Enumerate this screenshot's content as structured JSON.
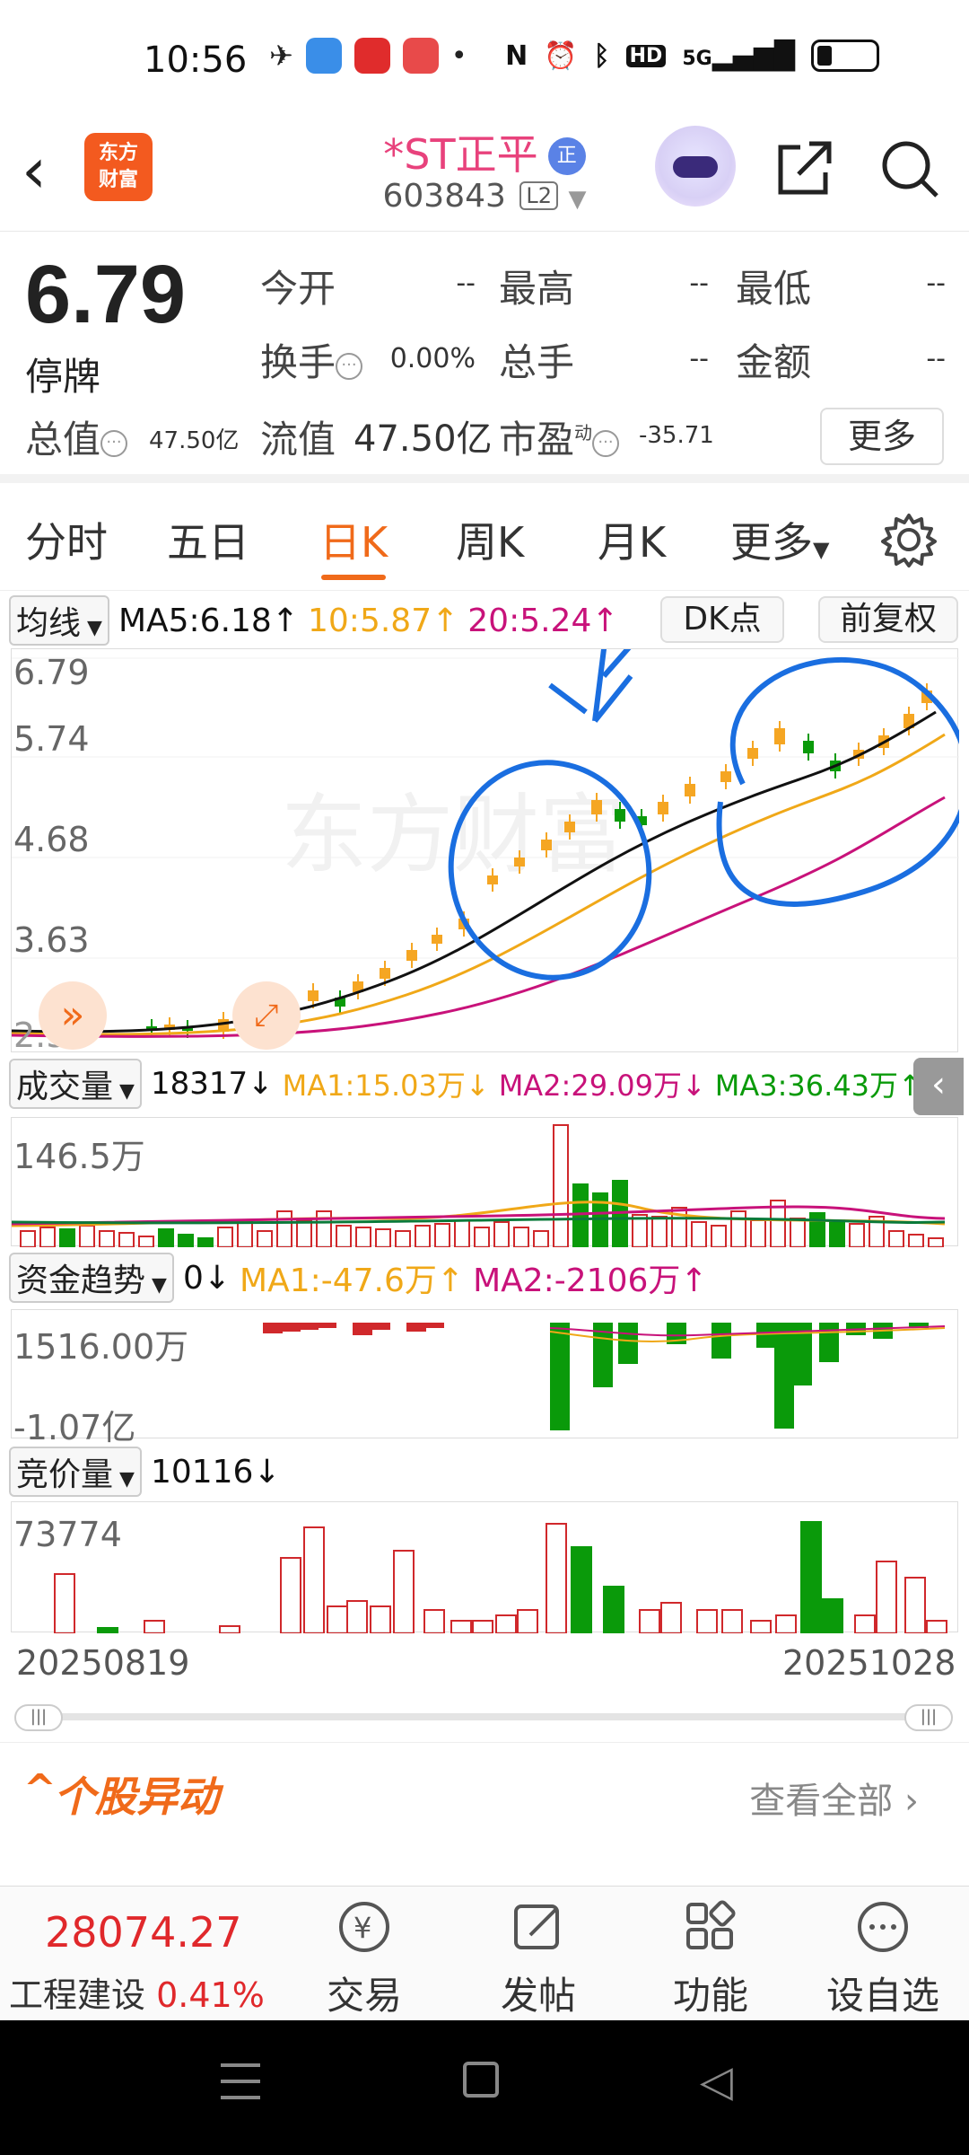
{
  "status_bar": {
    "time": "10:56",
    "network": "5G",
    "hd": "HD"
  },
  "header": {
    "back_icon": "chevron-left-icon",
    "logo_text_line1": "东方",
    "logo_text_line2": "财富",
    "stock_name": "*ST正平",
    "stock_badge": "正",
    "stock_code": "603843",
    "level": "L2"
  },
  "quote": {
    "price": "6.79",
    "status": "停牌",
    "open_label": "今开",
    "open_value": "--",
    "high_label": "最高",
    "high_value": "--",
    "low_label": "最低",
    "low_value": "--",
    "turnover_label": "换手",
    "turnover_value": "0.00%",
    "volume_label": "总手",
    "volume_value": "--",
    "amount_label": "金额",
    "amount_value": "--",
    "total_value_label": "总值",
    "total_value": "47.50亿",
    "float_value_label": "流值",
    "float_value": "47.50亿",
    "pe_label": "市盈",
    "pe_sup": "动",
    "pe_value": "-35.71",
    "more": "更多"
  },
  "tabs": [
    "分时",
    "五日",
    "日K",
    "周K",
    "月K",
    "更多"
  ],
  "active_tab": "日K",
  "kline": {
    "ma_dropdown": "均线",
    "ma5": "MA5:6.18",
    "ma10": "10:5.87",
    "ma20": "20:5.24",
    "dk_button": "DK点",
    "adjust_button": "前复权",
    "y_labels": [
      "6.79",
      "5.74",
      "4.68",
      "3.63",
      "2.57"
    ],
    "watermark": "东方财富"
  },
  "volume": {
    "dropdown": "成交量",
    "value": "18317",
    "ma1": "MA1:15.03万",
    "ma2": "MA2:29.09万",
    "ma3": "MA3:36.43万",
    "y_max": "146.5万"
  },
  "fund_trend": {
    "dropdown": "资金趋势",
    "value": "0",
    "ma1": "MA1:-47.6万",
    "ma2": "MA2:-2106万",
    "y_top": "1516.00万",
    "y_bottom": "-1.07亿"
  },
  "auction": {
    "dropdown": "竞价量",
    "value": "10116",
    "y_max": "73774"
  },
  "dates": {
    "start": "20250819",
    "end": "20251028"
  },
  "anomaly": {
    "title": "个股异动",
    "view_all": "查看全部"
  },
  "bottom_bar": {
    "index_value": "28074.27",
    "index_name": "工程建设",
    "index_change": "0.41%",
    "trade": "交易",
    "post": "发帖",
    "features": "功能",
    "watchlist": "设自选"
  },
  "colors": {
    "accent": "#f06a1a",
    "up": "#d0282b",
    "down": "#0a9a0a",
    "ma5": "#111111",
    "ma10": "#f0a818",
    "ma20": "#c8127a",
    "annotation": "#1a6ee0"
  }
}
